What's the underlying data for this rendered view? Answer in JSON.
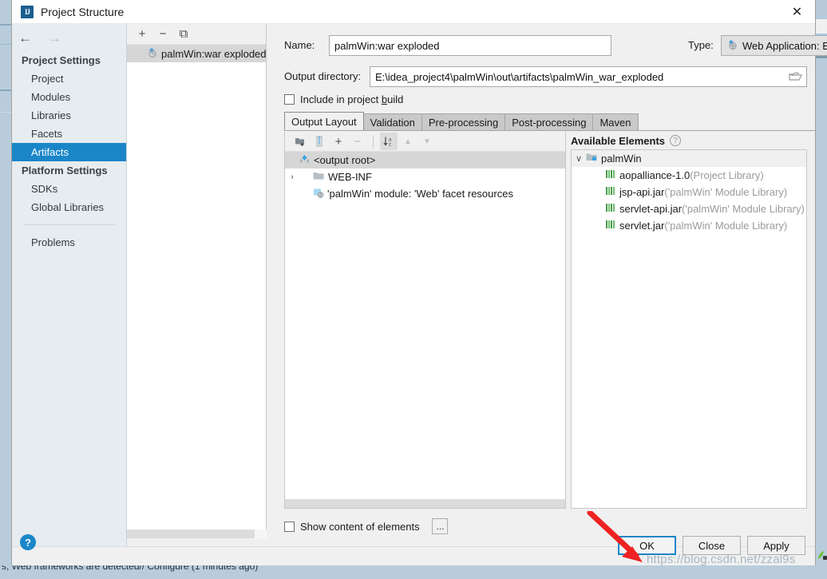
{
  "window": {
    "title": "Project Structure",
    "app_icon": "intellij-idea-icon",
    "close_label": "✕"
  },
  "sidebar": {
    "nav_back": "←",
    "nav_forward": "→",
    "groups": [
      {
        "label": "Project Settings",
        "items": [
          {
            "label": "Project",
            "selected": false
          },
          {
            "label": "Modules",
            "selected": false
          },
          {
            "label": "Libraries",
            "selected": false
          },
          {
            "label": "Facets",
            "selected": false
          },
          {
            "label": "Artifacts",
            "selected": true
          }
        ]
      },
      {
        "label": "Platform Settings",
        "items": [
          {
            "label": "SDKs",
            "selected": false
          },
          {
            "label": "Global Libraries",
            "selected": false
          }
        ]
      }
    ],
    "problems_label": "Problems"
  },
  "artifacts_panel": {
    "toolbar": [
      {
        "name": "add-artifact-button",
        "glyph": "+"
      },
      {
        "name": "remove-artifact-button",
        "glyph": "−"
      },
      {
        "name": "copy-artifact-button",
        "glyph": "⧉"
      }
    ],
    "items": [
      {
        "label": "palmWin:war exploded",
        "icon": "artifact-icon",
        "selected": true
      }
    ]
  },
  "form": {
    "name_label": "Name:",
    "name_value": "palmWin:war exploded",
    "type_label": "Type:",
    "type_value": "Web Application: Exploded",
    "type_icon": "web-artifact-icon",
    "output_label": "Output directory:",
    "output_value": "E:\\idea_project4\\palmWin\\out\\artifacts\\palmWin_war_exploded",
    "browse_icon": "folder-browse-icon",
    "include_in_build_label": "Include in project ",
    "include_in_build_mnemonic": "b",
    "include_in_build_tail": "uild",
    "include_in_build_checked": false
  },
  "tabs": [
    {
      "label": "Output Layout",
      "active": true
    },
    {
      "label": "Validation",
      "active": false
    },
    {
      "label": "Pre-processing",
      "active": false
    },
    {
      "label": "Post-processing",
      "active": false
    },
    {
      "label": "Maven",
      "active": false
    }
  ],
  "output_layout": {
    "toolbar": [
      {
        "name": "create-directory-button",
        "glyph": "🗀"
      },
      {
        "name": "create-archive-button",
        "glyph": "▓"
      },
      {
        "name": "add-copy-of-button",
        "glyph": "+"
      },
      {
        "name": "remove-element-button",
        "glyph": "−"
      },
      {
        "name": "sort-elements-button",
        "glyph": "↓"
      },
      {
        "name": "move-up-button",
        "glyph": "▲"
      },
      {
        "name": "move-down-button",
        "glyph": "▼"
      }
    ],
    "tree": [
      {
        "label": "<output root>",
        "icon": "output-root-icon",
        "indent": 0,
        "twisty": "",
        "selected": true,
        "muted": false
      },
      {
        "label": "WEB-INF",
        "icon": "folder-icon",
        "indent": 1,
        "twisty": "›",
        "selected": false,
        "muted": false
      },
      {
        "label": "'palmWin' module: 'Web' facet resources",
        "icon": "facet-resources-icon",
        "indent": 1,
        "twisty": "",
        "selected": false,
        "muted": false
      }
    ]
  },
  "available_elements": {
    "title": "Available Elements",
    "help_glyph": "?",
    "tree": [
      {
        "label": "palmWin",
        "suffix": "",
        "icon": "module-icon",
        "indent": 0,
        "twisty": "∨"
      },
      {
        "label": "aopalliance-1.0",
        "suffix": " (Project Library)",
        "icon": "library-icon",
        "indent": 1,
        "twisty": ""
      },
      {
        "label": "jsp-api.jar",
        "suffix": " ('palmWin' Module Library)",
        "icon": "library-icon",
        "indent": 1,
        "twisty": ""
      },
      {
        "label": "servlet-api.jar",
        "suffix": " ('palmWin' Module Library)",
        "icon": "library-icon",
        "indent": 1,
        "twisty": ""
      },
      {
        "label": "servlet.jar",
        "suffix": " ('palmWin' Module Library)",
        "icon": "library-icon",
        "indent": 1,
        "twisty": ""
      }
    ]
  },
  "bottom_bar": {
    "show_content_label": "Show content of elements",
    "show_content_checked": false,
    "ellipsis_label": "..."
  },
  "footer": {
    "help_glyph": "?",
    "buttons": [
      {
        "name": "ok-button",
        "label": "OK",
        "default": true
      },
      {
        "name": "close-button",
        "label": "Close",
        "default": false
      },
      {
        "name": "apply-button",
        "label": "Apply",
        "default": false
      }
    ]
  },
  "overlay": {
    "watermark": "https://blog.csdn.net/zzal9s",
    "arrow_color": "#ee2222"
  },
  "background": {
    "status_text": "s, Web frameworks are detected// Configure (1 minutes ago)"
  },
  "colors": {
    "accent": "#1a86c8",
    "dialog_bg": "#f0f0f0",
    "nav_bg": "#e6ecf0",
    "selection_bg": "#d6d6d6",
    "desktop_bg": "#b8ccdb"
  }
}
